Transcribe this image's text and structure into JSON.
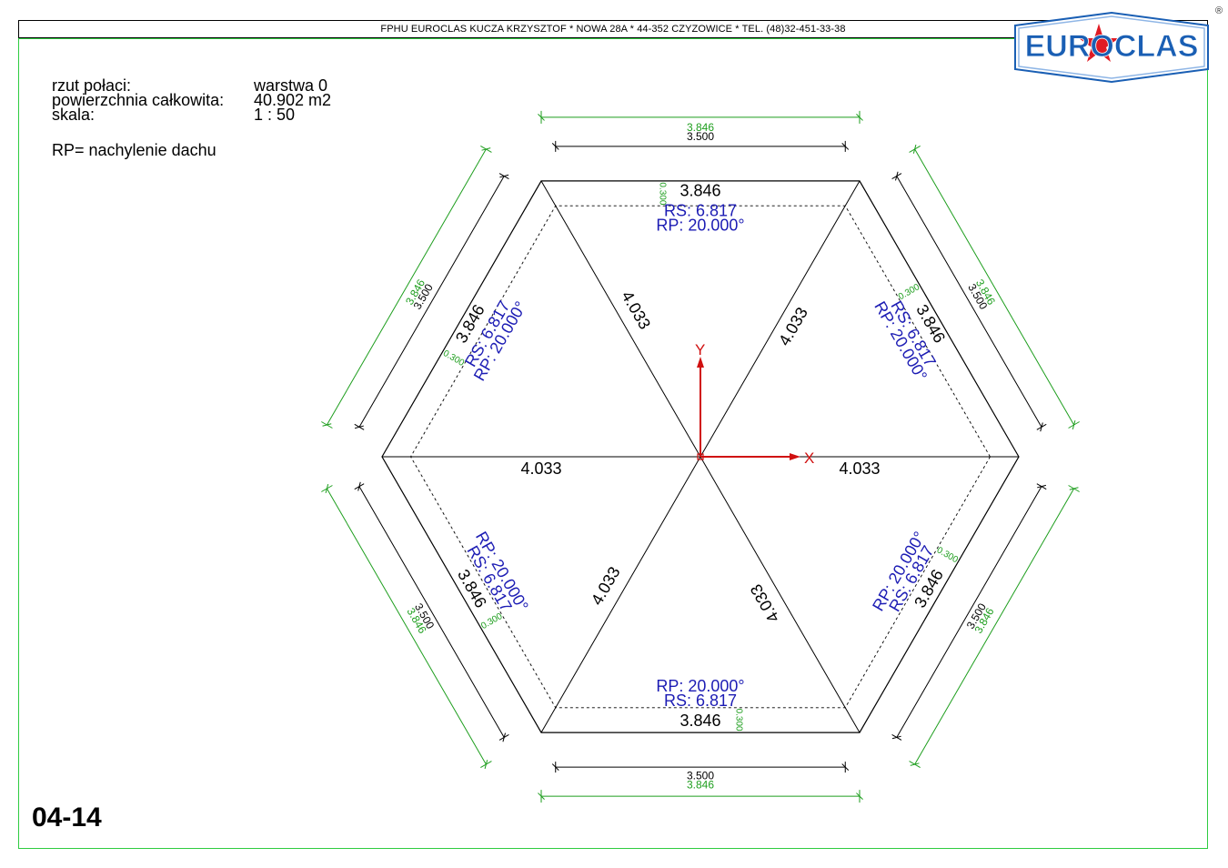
{
  "header": {
    "company_line": "FPHU EUROCLAS KUCZA KRZYSZTOF * NOWA 28A * 44-352 CZYZOWICE * TEL. (48)32-451-33-38"
  },
  "logo": {
    "text": "EUROCLAS",
    "registered_mark": "®",
    "colors": {
      "text": "#1a5fb4",
      "star": "#e01b24",
      "outline": "#1a5fb4"
    }
  },
  "info": {
    "rows": [
      {
        "label": "rzut połaci:",
        "value": "warstwa 0"
      },
      {
        "label": "powierzchnia całkowita:",
        "value": "40.902 m2"
      },
      {
        "label": "skala:",
        "value": "1 : 50"
      }
    ],
    "rp_note": "RP= nachylenie dachu"
  },
  "sheet_id": "04-14",
  "drawing": {
    "colors": {
      "outline": "#000000",
      "dimension_green": "#1e9e1e",
      "annotation_blue": "#1c1cb4",
      "axis_red": "#d01010"
    },
    "outer_edge_length": "3.846",
    "inner_dimension": "3.500",
    "overhang": "0.300",
    "ridge_length": "4.033",
    "rs_label": "RS:",
    "rs_value": "6.817",
    "rp_label": "RP:",
    "rp_value": "20.000°",
    "axis_x": "X",
    "axis_y": "Y"
  }
}
